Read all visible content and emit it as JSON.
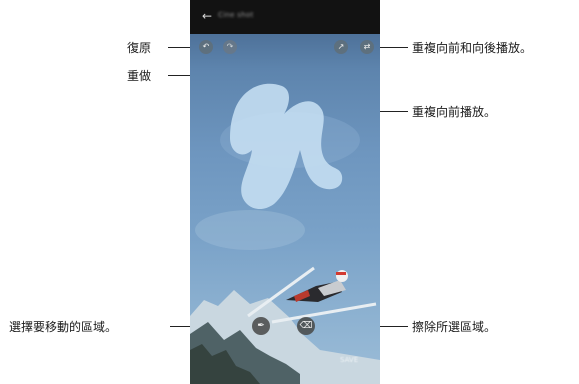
{
  "callouts": {
    "undo": "復原",
    "redo": "重做",
    "repeat_both": "重複向前和向後播放。",
    "repeat_forward": "重複向前播放。",
    "select_move": "選擇要移動的區域。",
    "erase": "擦除所選區域。"
  },
  "phone": {
    "title": "Cine shot",
    "save_label": "SAVE",
    "icons": {
      "back": "arrow-left",
      "undo": "undo",
      "redo": "redo",
      "repeat_forward": "play-forward",
      "repeat_both": "repeat",
      "select": "brush",
      "erase": "eraser"
    }
  }
}
